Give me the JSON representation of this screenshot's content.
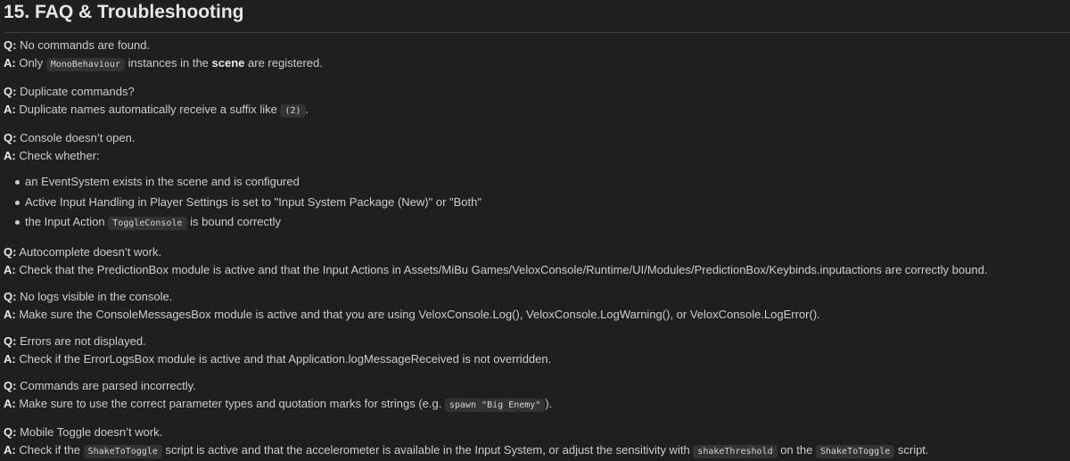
{
  "heading": "15. FAQ & Troubleshooting",
  "labels": {
    "q": "Q:",
    "a": "A:"
  },
  "faq": [
    {
      "q": "No commands are found.",
      "a": {
        "p1": "Only ",
        "code1": "MonoBehaviour",
        "p2": " instances in the ",
        "strong": "scene",
        "p3": " are registered."
      }
    },
    {
      "q": "Duplicate commands?",
      "a": {
        "p1": "Duplicate names automatically receive a suffix like ",
        "code1": "(2)",
        "p2": "."
      }
    },
    {
      "q": "Console doesn’t open.",
      "a": {
        "p1": "Check whether:"
      },
      "bullets": [
        {
          "text": "an EventSystem exists in the scene and is configured"
        },
        {
          "text": "Active Input Handling in Player Settings is set to \"Input System Package (New)\" or \"Both\""
        },
        {
          "p1": "the Input Action ",
          "code1": "ToggleConsole",
          "p2": " is bound correctly"
        }
      ]
    },
    {
      "q": "Autocomplete doesn’t work.",
      "a": {
        "p1": "Check that the PredictionBox module is active and that the Input Actions in Assets/MiBu Games/VeloxConsole/Runtime/UI/Modules/PredictionBox/Keybinds.inputactions are correctly bound."
      }
    },
    {
      "q": "No logs visible in the console.",
      "a": {
        "p1": "Make sure the ConsoleMessagesBox module is active and that you are using VeloxConsole.Log(), VeloxConsole.LogWarning(), or VeloxConsole.LogError()."
      }
    },
    {
      "q": "Errors are not displayed.",
      "a": {
        "p1": "Check if the ErrorLogsBox module is active and that Application.logMessageReceived is not overridden."
      }
    },
    {
      "q": "Commands are parsed incorrectly.",
      "a": {
        "p1": "Make sure to use the correct parameter types and quotation marks for strings (e.g. ",
        "code1": "spawn \"Big Enemy\"",
        "p2": ")."
      }
    },
    {
      "q": "Mobile Toggle doesn’t work.",
      "a": {
        "p1": "Check if the ",
        "code1": "ShakeToToggle",
        "p2": " script is active and that the accelerometer is available in the Input System, or adjust the sensitivity with ",
        "code2": "shakeThreshold",
        "p3": " on the ",
        "code3": "ShakeToToggle",
        "p4": " script."
      }
    }
  ]
}
